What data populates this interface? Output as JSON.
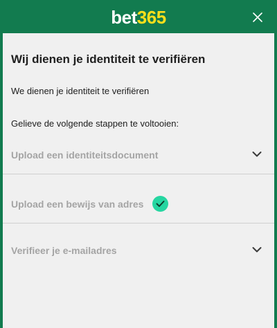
{
  "header": {
    "logo_part1": "bet",
    "logo_part2": "365"
  },
  "dialog": {
    "title": "Wij dienen je identiteit te verifiëren",
    "intro": "We dienen je identiteit te verifiëren",
    "instruction": "Gelieve de volgende stappen te voltooien:"
  },
  "steps": [
    {
      "label": "Upload een identiteitsdocument",
      "icon": "chevron-down-icon",
      "completed": false
    },
    {
      "label": "Upload een bewijs van adres",
      "icon": "check-circle-icon",
      "completed": true
    },
    {
      "label": "Verifieer je e-mailadres",
      "icon": "chevron-down-icon",
      "completed": false
    }
  ],
  "colors": {
    "brand_green": "#127b4f",
    "logo_yellow": "#ffdf1b",
    "check_green": "#26d6a1",
    "step_text": "#a4a4a4"
  }
}
